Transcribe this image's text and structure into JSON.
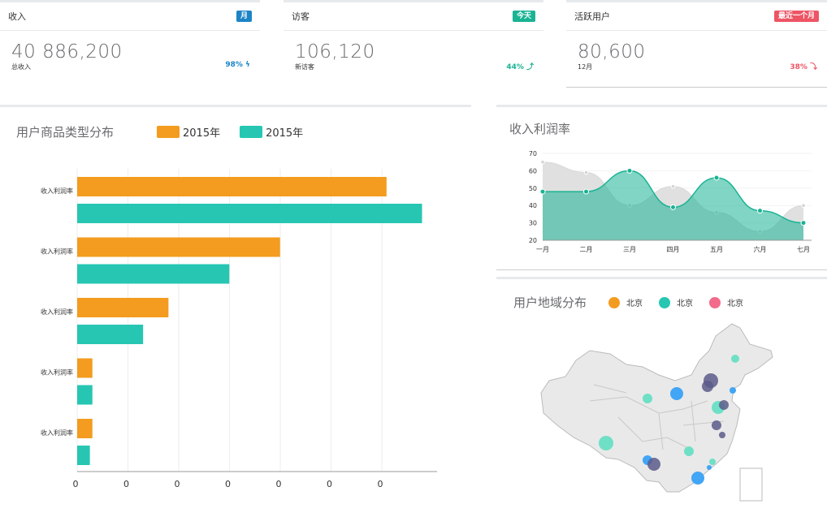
{
  "colors": {
    "blue": "#1c84c6",
    "green": "#1ab394",
    "red": "#ed5565",
    "orange": "#f39c1f",
    "teal": "#26c6b2",
    "pink": "#f26b8a",
    "grayArea": "#e5e5e5"
  },
  "stats": [
    {
      "title": "收入",
      "badge": "月",
      "badge_color": "#1c84c6",
      "value": "40 886,200",
      "sub": "总收入",
      "pct": "98% ϟ",
      "pct_color": "#1c84c6"
    },
    {
      "title": "访客",
      "badge": "今天",
      "badge_color": "#1ab394",
      "value": "106,120",
      "sub": "新访客",
      "pct": "44% ⤴",
      "pct_color": "#1ab394"
    },
    {
      "title": "活跃用户",
      "badge": "最近一个月",
      "badge_color": "#ed5565",
      "value": "80,600",
      "sub": "12月",
      "pct": "38% ⤵",
      "pct_color": "#ed5565"
    }
  ],
  "barPanel": {
    "title": "用户商品类型分布",
    "legend": [
      "2015年",
      "2015年"
    ]
  },
  "linePanel": {
    "title": "收入利润率"
  },
  "mapPanel": {
    "title": "用户地域分布",
    "legend": [
      "北京",
      "北京",
      "北京"
    ],
    "map_icon": "china-map"
  },
  "chart_data": [
    {
      "type": "bar",
      "orientation": "horizontal",
      "categories": [
        "收入利润率",
        "收入利润率",
        "收入利润率",
        "收入利润率",
        "收入利润率"
      ],
      "series": [
        {
          "name": "2015年",
          "color": "#f39c1f",
          "values": [
            6.1,
            4.0,
            1.8,
            0.3,
            0.3
          ]
        },
        {
          "name": "2015年",
          "color": "#26c6b2",
          "values": [
            6.8,
            3.0,
            1.3,
            0.3,
            0.25
          ]
        }
      ],
      "xticks": [
        "0",
        "0",
        "0",
        "0",
        "0",
        "0",
        "0"
      ],
      "xlim": [
        0,
        7
      ]
    },
    {
      "type": "area",
      "categories": [
        "一月",
        "二月",
        "三月",
        "四月",
        "五月",
        "六月",
        "七月"
      ],
      "ylim": [
        20,
        70
      ],
      "yticks": [
        "20",
        "30",
        "40",
        "50",
        "60",
        "70"
      ],
      "series": [
        {
          "color": "#e5e5e5",
          "values": [
            65,
            59,
            40,
            51,
            36,
            25,
            40
          ]
        },
        {
          "color": "#1ab394",
          "values": [
            48,
            48,
            60,
            39,
            56,
            37,
            30
          ]
        }
      ]
    }
  ]
}
